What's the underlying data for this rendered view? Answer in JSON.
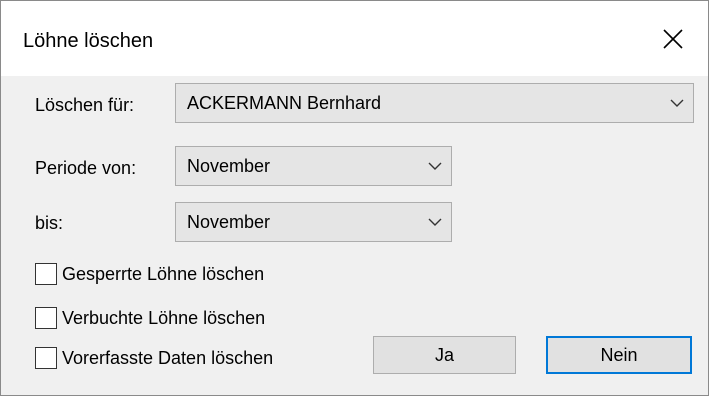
{
  "window": {
    "title": "Löhne löschen",
    "close_icon": "close-icon"
  },
  "form": {
    "loeschen_fuer": {
      "label": "Löschen für:",
      "value": "ACKERMANN Bernhard"
    },
    "periode_von": {
      "label": "Periode von:",
      "value": "November"
    },
    "bis": {
      "label": "bis:",
      "value": "November"
    }
  },
  "options": [
    {
      "label": "Gesperrte Löhne löschen",
      "checked": false
    },
    {
      "label": "Verbuchte Löhne löschen",
      "checked": false
    },
    {
      "label": "Vorerfasste Daten löschen",
      "checked": false
    }
  ],
  "buttons": {
    "yes": "Ja",
    "no": "Nein"
  },
  "colors": {
    "accent": "#0078d7",
    "background": "#f0f0f0",
    "titlebar": "#ffffff"
  }
}
